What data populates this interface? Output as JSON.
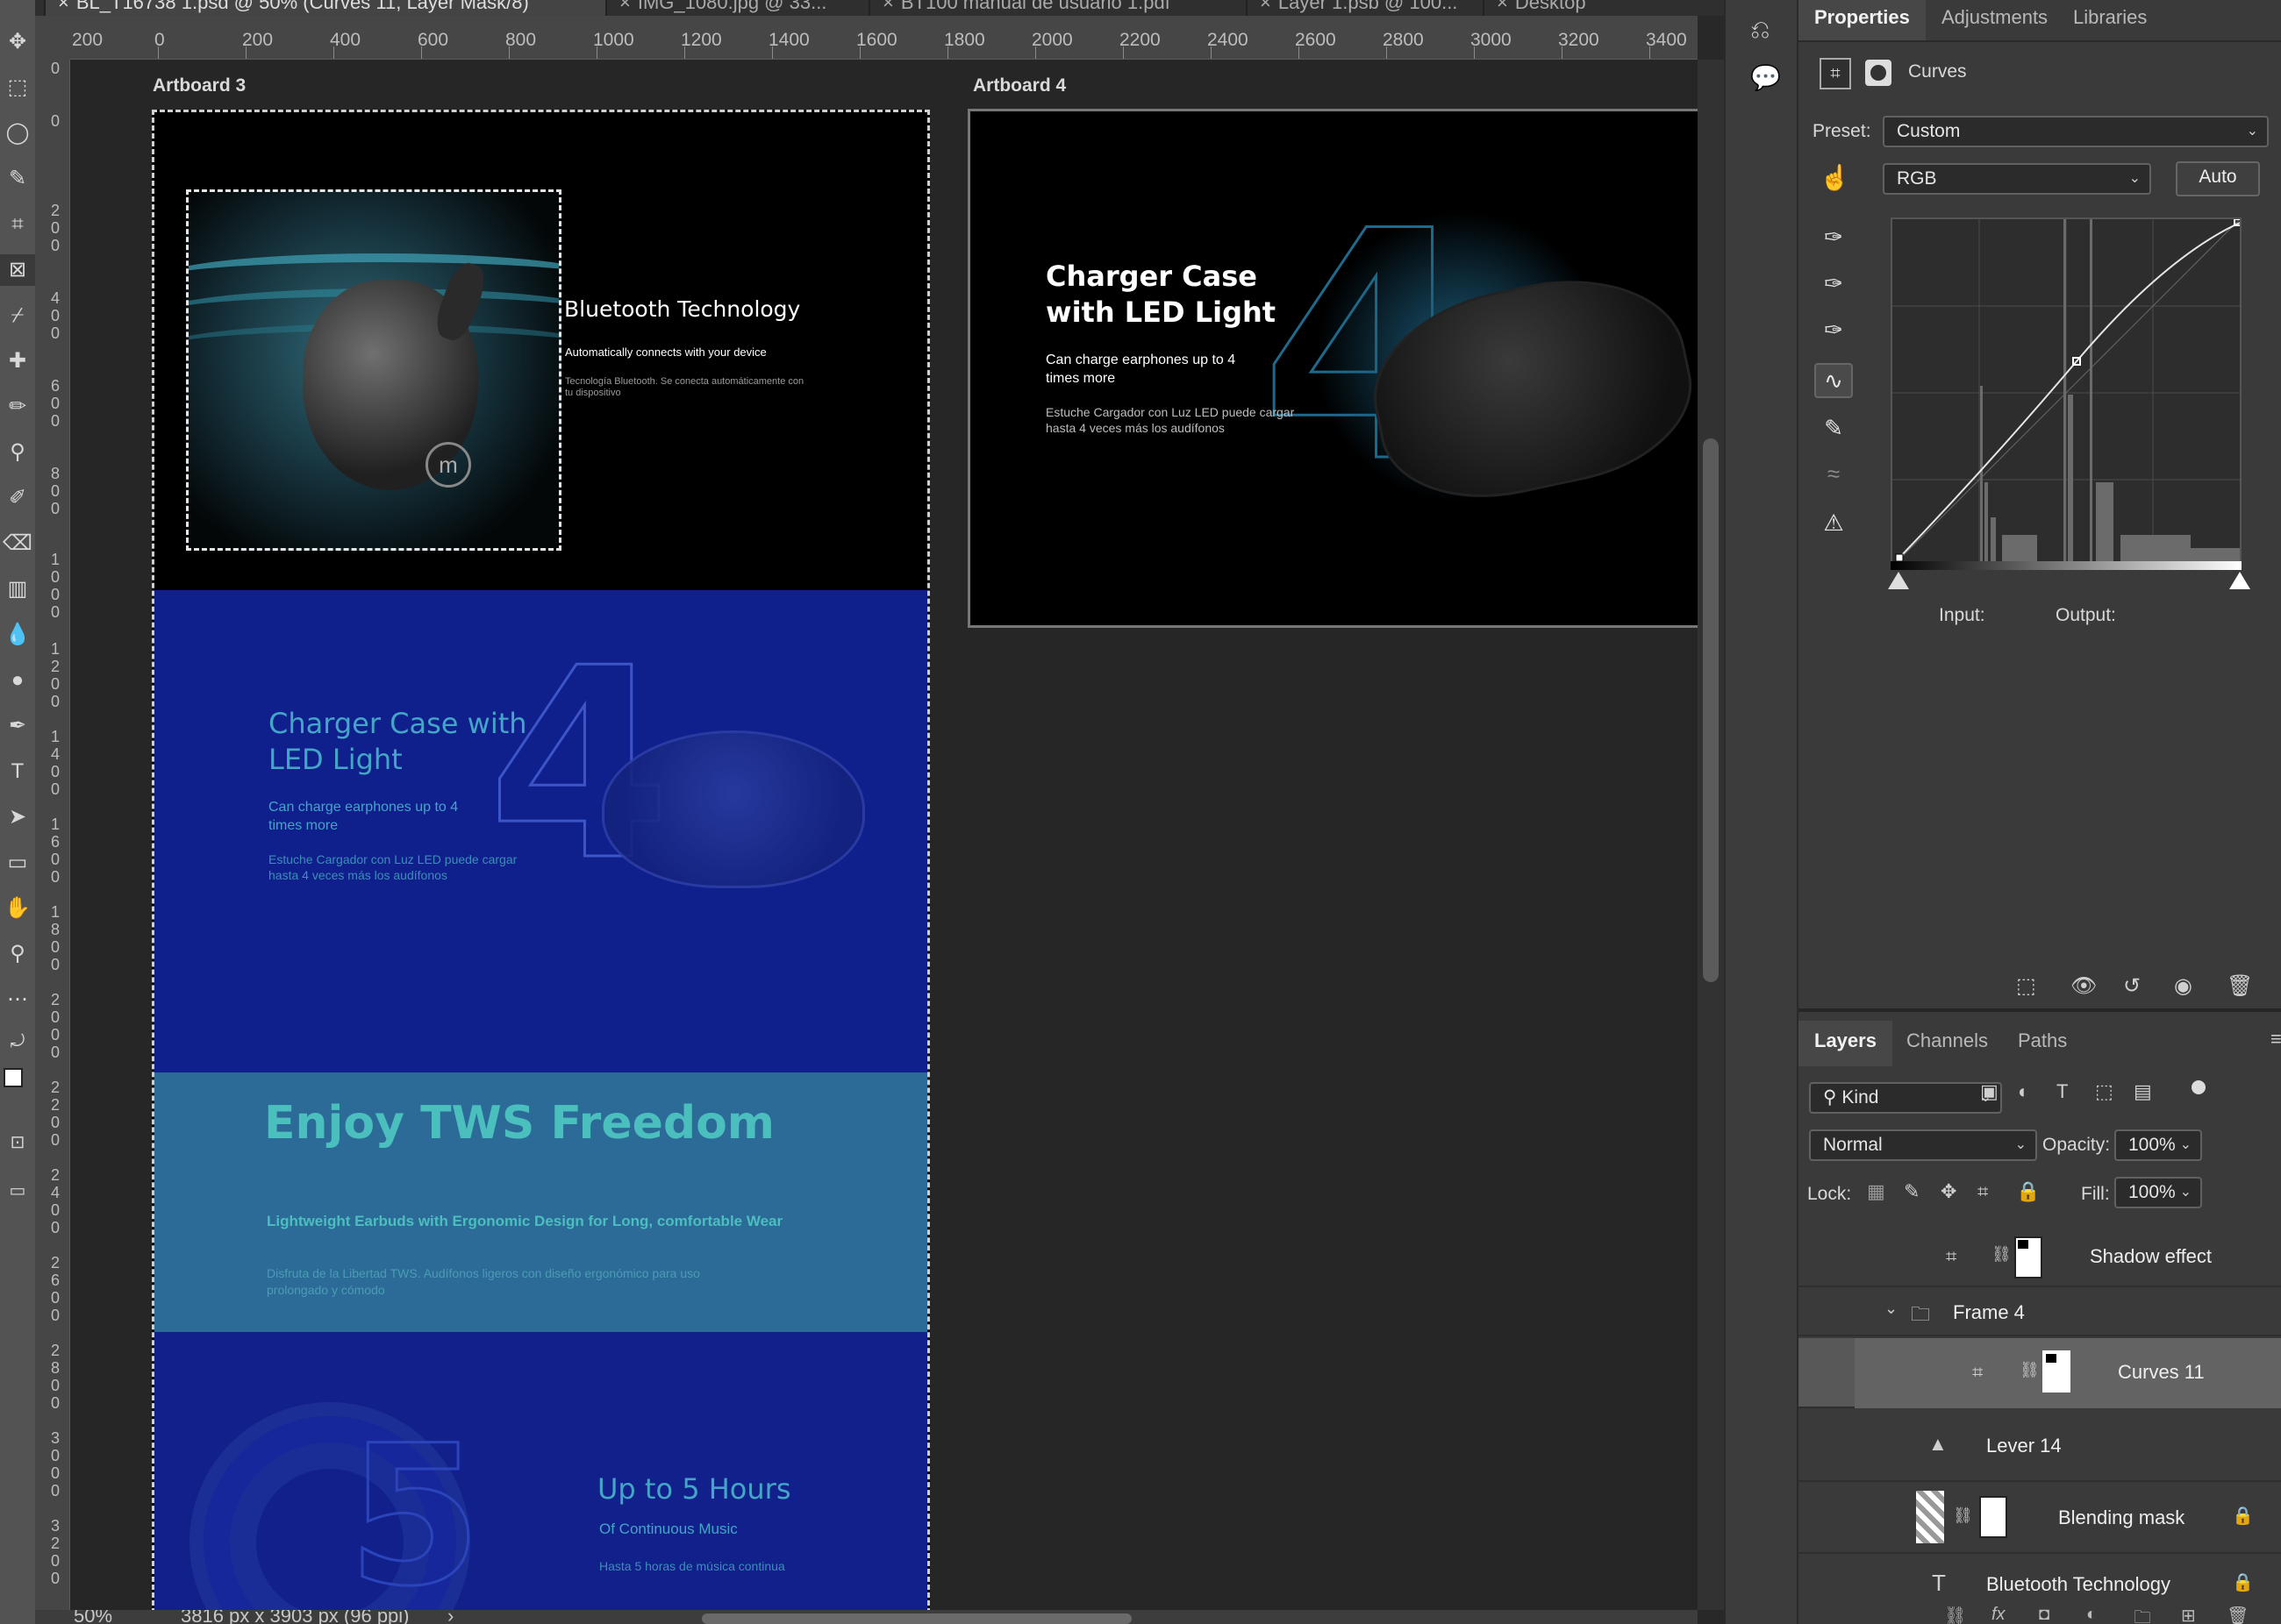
{
  "tabs": [
    {
      "label": "BL_T16738 1.psd @ 50% (Curves 11, Layer Mask/8)"
    },
    {
      "label": "IMG_1080.jpg @ 33..."
    },
    {
      "label": "BT100 manual de usuario 1.pdf"
    },
    {
      "label": "Layer 1.psb @ 100..."
    },
    {
      "label": "Desktop"
    }
  ],
  "ruler": {
    "h_ticks": [
      "200",
      "0",
      "200",
      "400",
      "600",
      "800",
      "1000",
      "1200",
      "1400",
      "1600",
      "1800",
      "2000",
      "2200",
      "2400",
      "2600",
      "2800",
      "3000",
      "3200",
      "3400"
    ],
    "v_ticks": [
      "0",
      "0",
      "200",
      "400",
      "600",
      "800",
      "1000",
      "1200",
      "1400",
      "1600",
      "1800",
      "2000",
      "2200",
      "2400",
      "2600",
      "2800",
      "3000",
      "3200",
      "3400"
    ]
  },
  "canvas": {
    "artboard3": {
      "label": "Artboard 3",
      "bt_title": "Bluetooth Technology",
      "bt_sub": "Automatically connects with your device",
      "bt_es": "Tecnología Bluetooth. Se conecta automáticamente con tu dispositivo",
      "charger_title": "Charger Case with LED Light",
      "charger_sub": "Can charge earphones up to 4 times more",
      "charger_es": "Estuche Cargador con Luz LED puede cargar hasta 4 veces más los audífonos",
      "tws_title": "Enjoy TWS Freedom",
      "tws_sub": "Lightweight Earbuds with Ergonomic Design for Long, comfortable Wear",
      "tws_es": "Disfruta de la Libertad TWS. Audífonos ligeros con diseño ergonómico para uso prolongado y cómodo",
      "hours_title": "Up to 5 Hours",
      "hours_sub": "Of Continuous Music",
      "hours_es": "Hasta 5 horas de música continua"
    },
    "artboard4": {
      "label": "Artboard 4",
      "title": "Charger Case with LED Light",
      "sub": "Can charge earphones up to 4 times more",
      "es": "Estuche Cargador con Luz LED puede cargar hasta 4 veces más los audífonos"
    }
  },
  "status": {
    "zoom": "50%",
    "doc_size": "3816 px x 3903 px (96 ppi)",
    "arrow": "›"
  },
  "properties": {
    "tabs": [
      "Properties",
      "Adjustments",
      "Libraries"
    ],
    "panel_title": "Curves",
    "preset_label": "Preset:",
    "preset_value": "Custom",
    "channel_value": "RGB",
    "auto_label": "Auto",
    "input_label": "Input:",
    "output_label": "Output:"
  },
  "layers_panel": {
    "tabs": [
      "Layers",
      "Channels",
      "Paths"
    ],
    "filter_kind": "Kind",
    "blend_mode": "Normal",
    "opacity_label": "Opacity:",
    "opacity_value": "100%",
    "lock_label": "Lock:",
    "fill_label": "Fill:",
    "fill_value": "100%",
    "layers": [
      {
        "name": "Shadow effect"
      },
      {
        "name": "Frame 4"
      },
      {
        "name": "Curves 11"
      },
      {
        "name": "Lever 14"
      },
      {
        "name": "Blending mask"
      },
      {
        "name": "Bluetooth Technology"
      }
    ]
  },
  "colors": {
    "accent_blue": "#0f1f8c",
    "tws_band": "#2c6b97",
    "panel_bg": "#3a3a3a",
    "selection": "#585858"
  }
}
